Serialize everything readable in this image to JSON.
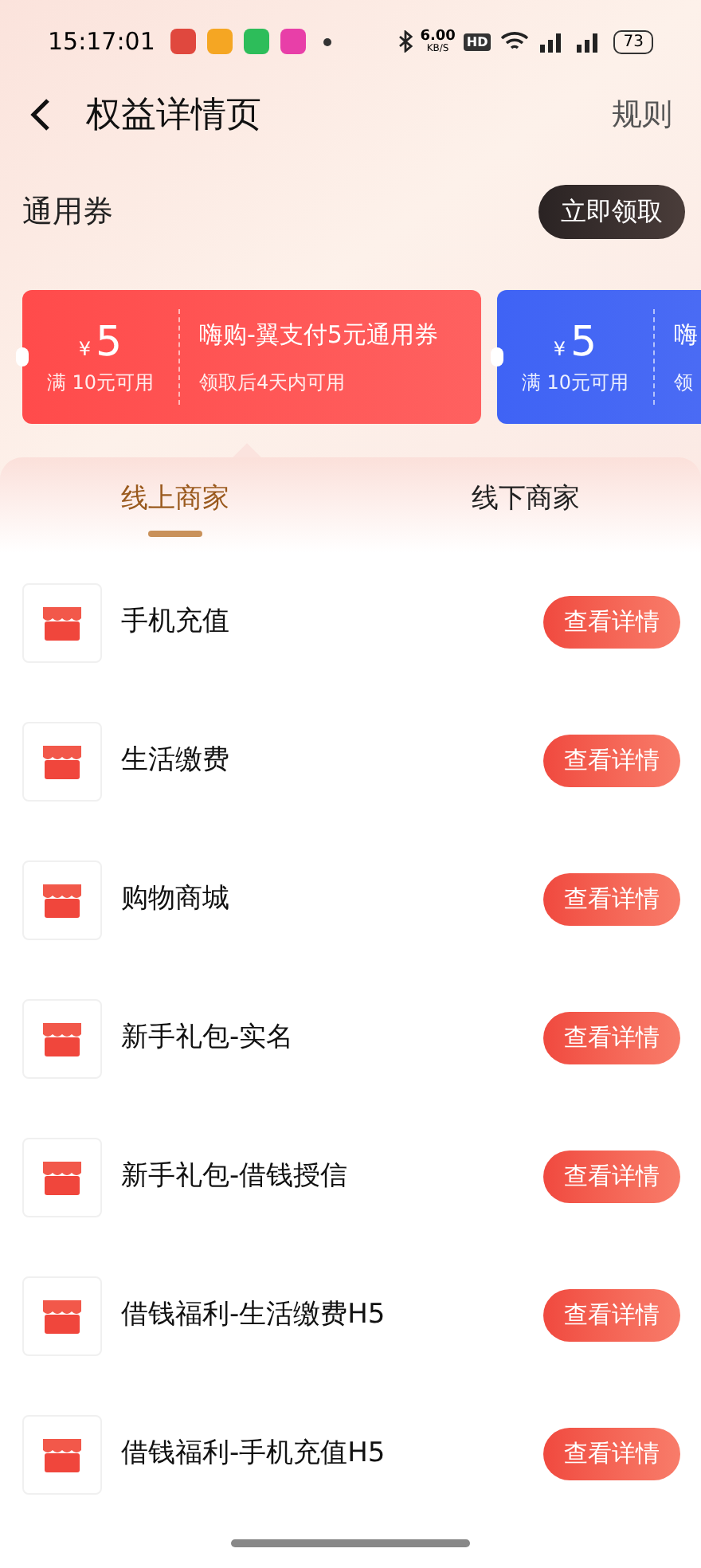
{
  "status_bar": {
    "time": "15:17:01",
    "notification_icons": [
      {
        "color": "#e0483e"
      },
      {
        "color": "#f5a623"
      },
      {
        "color": "#2dbd5a"
      },
      {
        "color": "#e83fa8"
      }
    ],
    "net_speed": "6.00",
    "net_unit": "KB/S",
    "hd_badge": "HD",
    "battery": "73"
  },
  "header": {
    "title": "权益详情页",
    "action": "规则"
  },
  "section": {
    "title": "通用券",
    "button": "立即领取"
  },
  "coupons": [
    {
      "color": "#ff4b4b",
      "currency": "¥",
      "amount": "5",
      "condition": "满 10元可用",
      "name": "嗨购-翼支付5元通用券",
      "validity": "领取后4天内可用"
    },
    {
      "color": "#3f63f5",
      "currency": "¥",
      "amount": "5",
      "condition": "满 10元可用",
      "name": "嗨",
      "validity": "领"
    }
  ],
  "tabs": [
    {
      "label": "线上商家",
      "selected": true
    },
    {
      "label": "线下商家",
      "selected": false
    }
  ],
  "merchants": [
    {
      "name": "手机充值",
      "button": "查看详情"
    },
    {
      "name": "生活缴费",
      "button": "查看详情"
    },
    {
      "name": "购物商城",
      "button": "查看详情"
    },
    {
      "name": "新手礼包-实名",
      "button": "查看详情"
    },
    {
      "name": "新手礼包-借钱授信",
      "button": "查看详情"
    },
    {
      "name": "借钱福利-生活缴费H5",
      "button": "查看详情"
    },
    {
      "name": "借钱福利-手机充值H5",
      "button": "查看详情"
    }
  ]
}
